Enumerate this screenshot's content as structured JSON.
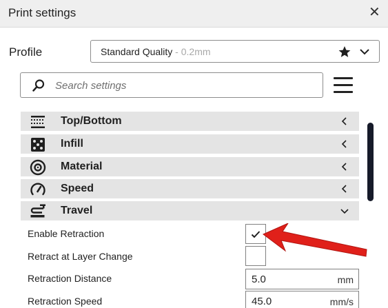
{
  "window": {
    "title": "Print settings",
    "close_symbol": "✕"
  },
  "profile": {
    "label": "Profile",
    "name": "Standard Quality",
    "detail": " - 0.2mm"
  },
  "search": {
    "placeholder": "Search settings"
  },
  "categories": [
    {
      "label": "Top/Bottom",
      "icon": "top-bottom-icon",
      "expanded": false
    },
    {
      "label": "Infill",
      "icon": "infill-icon",
      "expanded": false
    },
    {
      "label": "Material",
      "icon": "material-icon",
      "expanded": false
    },
    {
      "label": "Speed",
      "icon": "speed-icon",
      "expanded": false
    },
    {
      "label": "Travel",
      "icon": "travel-icon",
      "expanded": true
    }
  ],
  "settings": {
    "enable_retraction": {
      "label": "Enable Retraction",
      "checked": true
    },
    "retract_layer_change": {
      "label": "Retract at Layer Change",
      "checked": false
    },
    "retraction_distance": {
      "label": "Retraction Distance",
      "value": "5.0",
      "unit": "mm"
    },
    "retraction_speed": {
      "label": "Retraction Speed",
      "value": "45.0",
      "unit": "mm/s"
    }
  },
  "colors": {
    "accent": "#1b2033",
    "annotation_arrow": "#e0201a",
    "category_bg": "#e4e4e4"
  }
}
